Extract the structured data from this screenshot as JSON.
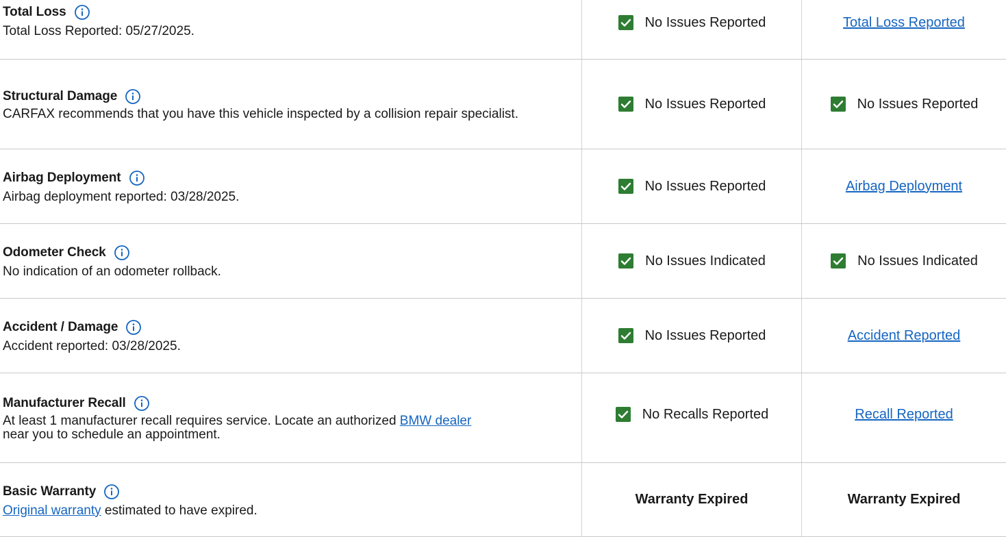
{
  "colors": {
    "check_green": "#2e7d32",
    "info_blue": "#1565c0",
    "link_blue": "#1565c0",
    "divider": "#c8c8c8"
  },
  "icons": {
    "info": "info-circle-icon",
    "check": "green-checkbox-icon"
  },
  "rows": [
    {
      "title": "Total Loss",
      "desc": "Total Loss Reported: 05/27/2025.",
      "mid_status": "No Issues Reported",
      "right_link": "Total Loss Reported"
    },
    {
      "title": "Structural Damage",
      "desc": "CARFAX recommends that you have this vehicle inspected by a collision repair specialist.",
      "mid_status": "No Issues Reported",
      "right_status": "No Issues Reported"
    },
    {
      "title": "Airbag Deployment",
      "desc": "Airbag deployment reported: 03/28/2025.",
      "mid_status": "No Issues Reported",
      "right_link": "Airbag Deployment"
    },
    {
      "title": "Odometer Check",
      "desc": "No indication of an odometer rollback.",
      "mid_status": "No Issues Indicated",
      "right_status": "No Issues Indicated"
    },
    {
      "title": "Accident / Damage",
      "desc": "Accident reported: 03/28/2025.",
      "mid_status": "No Issues Reported",
      "right_link": "Accident Reported"
    },
    {
      "title": "Manufacturer Recall",
      "desc_before": "At least 1 manufacturer recall requires service. Locate an authorized ",
      "desc_link": "BMW dealer",
      "desc_after": "near you to schedule an appointment.",
      "mid_status": "No Recalls Reported",
      "right_link": "Recall Reported"
    },
    {
      "title": "Basic Warranty",
      "desc_link": "Original warranty",
      "desc_after": " estimated to have expired.",
      "mid_bold": "Warranty Expired",
      "right_bold": "Warranty Expired"
    }
  ]
}
